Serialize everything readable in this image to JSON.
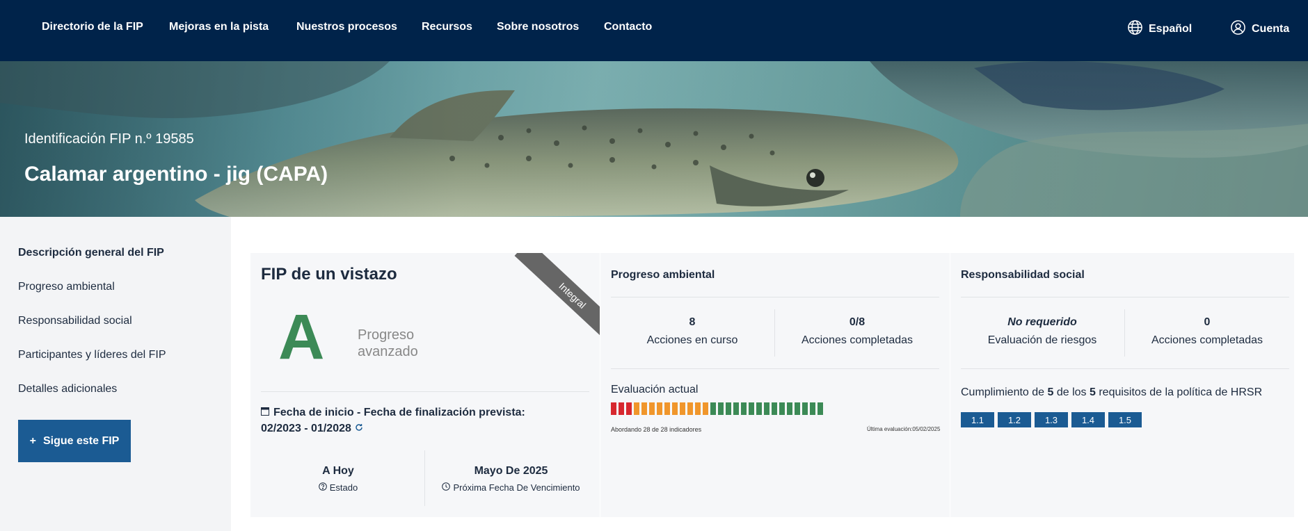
{
  "nav": {
    "items": [
      "Directorio de la FIP",
      "Mejoras en la pista",
      "Nuestros procesos",
      "Recursos",
      "Sobre nosotros",
      "Contacto"
    ],
    "language": "Español",
    "account": "Cuenta",
    "background_color": "#00234a"
  },
  "hero": {
    "fip_id": "Identificación FIP n.º 19585",
    "title": "Calamar argentino - jig (CAPA)"
  },
  "sidebar": {
    "items": [
      "Descripción general del FIP",
      "Progreso ambiental",
      "Responsabilidad social",
      "Participantes y líderes del FIP",
      "Detalles adicionales"
    ],
    "active": "Descripción general del FIP",
    "follow_button": "Sigue este FIP",
    "follow_icon": "plus-icon"
  },
  "glance": {
    "title": "FIP de un vistazo",
    "ribbon": "Integral",
    "grade": "A",
    "grade_label_line1": "Progreso",
    "grade_label_line2": "avanzado",
    "grade_color": "#3c8a56",
    "dates_label": "Fecha de inicio - Fecha de finalización prevista:",
    "dates_value": "02/2023 - 01/2028",
    "status_value": "A Hoy",
    "status_label": "Estado",
    "due_value": "Mayo De 2025",
    "due_label": "Próxima Fecha De Vencimiento"
  },
  "environmental": {
    "title": "Progreso ambiental",
    "actions_in_progress": "8",
    "actions_in_progress_label": "Acciones en curso",
    "actions_completed": "0/8",
    "actions_completed_label": "Acciones completadas",
    "evaluation_label": "Evaluación actual",
    "indicators_text": "Abordando 28 de 28 indicadores",
    "last_eval": "Última evaluación:05/02/2025",
    "indicator_counts": {
      "red": 3,
      "orange": 10,
      "green": 15
    },
    "colors": {
      "red": "#d7282f",
      "orange": "#f0962b",
      "green": "#3c8a56"
    }
  },
  "social": {
    "title": "Responsabilidad social",
    "risk_value": "No requerido",
    "risk_label": "Evaluación de riesgos",
    "actions_completed": "0",
    "actions_completed_label": "Acciones completadas",
    "compliance_prefix": "Cumplimiento de ",
    "compliance_met": "5",
    "compliance_mid": " de los ",
    "compliance_total": "5",
    "compliance_suffix": " requisitos de la política de HRSR",
    "requirements": [
      "1.1",
      "1.2",
      "1.3",
      "1.4",
      "1.5"
    ],
    "chip_color": "#1b5b93"
  }
}
